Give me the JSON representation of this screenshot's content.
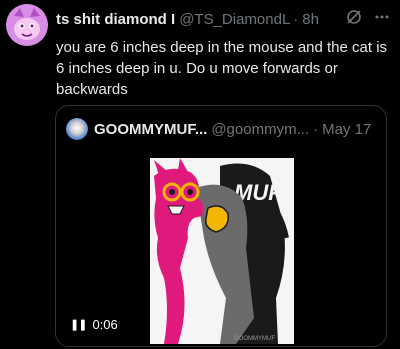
{
  "tweet": {
    "display_name": "ts shit diamond I",
    "handle": "@TS_DiamondL",
    "separator": "·",
    "time": "8h",
    "text": "you are 6 inches deep in the mouse and the cat is 6 inches deep in u. Do u move forwards or backwards",
    "icons": {
      "avatar": "pink-character-avatar",
      "grok": "grok-icon",
      "more": "more-icon"
    }
  },
  "quote": {
    "display_name": "GOOMMYMUF...",
    "handle": "@goommym...",
    "separator": "·",
    "time": "May 17",
    "media": {
      "type": "video",
      "timestamp": "0:06",
      "artwork_text": "MUFF",
      "watermark": "GOOMMYMUF",
      "icons": {
        "pause": "pause-icon"
      },
      "colors": {
        "pink": "#e0197d",
        "black": "#1a1a1a",
        "yellow": "#f2b705",
        "white": "#f5f5f5"
      }
    }
  }
}
